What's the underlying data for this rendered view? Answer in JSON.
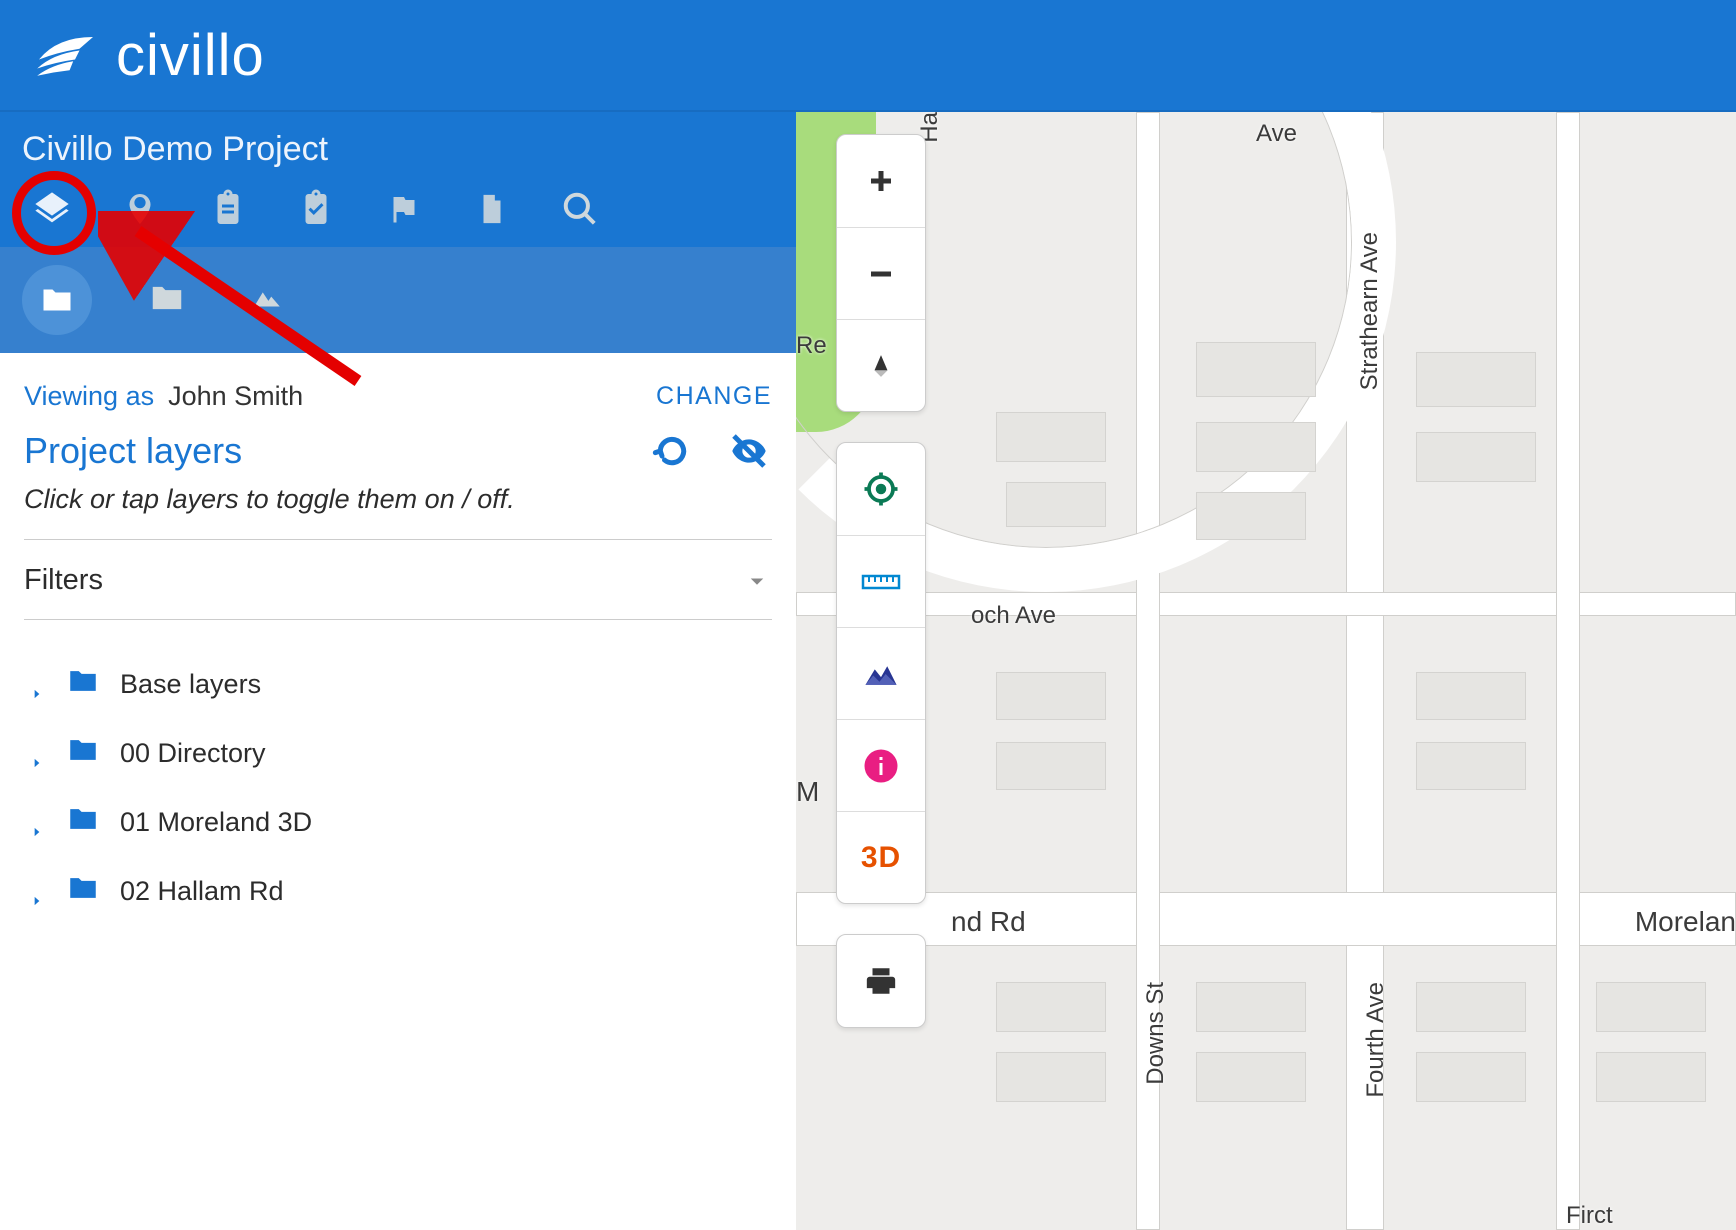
{
  "brand": {
    "name": "civillo"
  },
  "project": {
    "title": "Civillo Demo Project"
  },
  "sidebar": {
    "viewing_label": "Viewing as",
    "viewing_name": "John Smith",
    "change_label": "CHANGE",
    "layers_title": "Project layers",
    "hint": "Click or tap layers to toggle them on / off.",
    "filters_label": "Filters",
    "tree": [
      {
        "label": "Base layers"
      },
      {
        "label": "00 Directory"
      },
      {
        "label": "01 Moreland 3D"
      },
      {
        "label": "02 Hallam Rd"
      }
    ]
  },
  "map": {
    "streets": {
      "strathearn": "Strathearn Ave",
      "loch": "och Ave",
      "moreland_left": "nd Rd",
      "moreland_right": "Morelan",
      "downs": "Downs St",
      "fourth": "Fourth Ave",
      "ave_top": "Ave",
      "m_left": "M",
      "re_left": "Re",
      "ha_top": "Ha",
      "first_bottom": "Firct"
    },
    "controls": {
      "threeD": "3D"
    }
  }
}
